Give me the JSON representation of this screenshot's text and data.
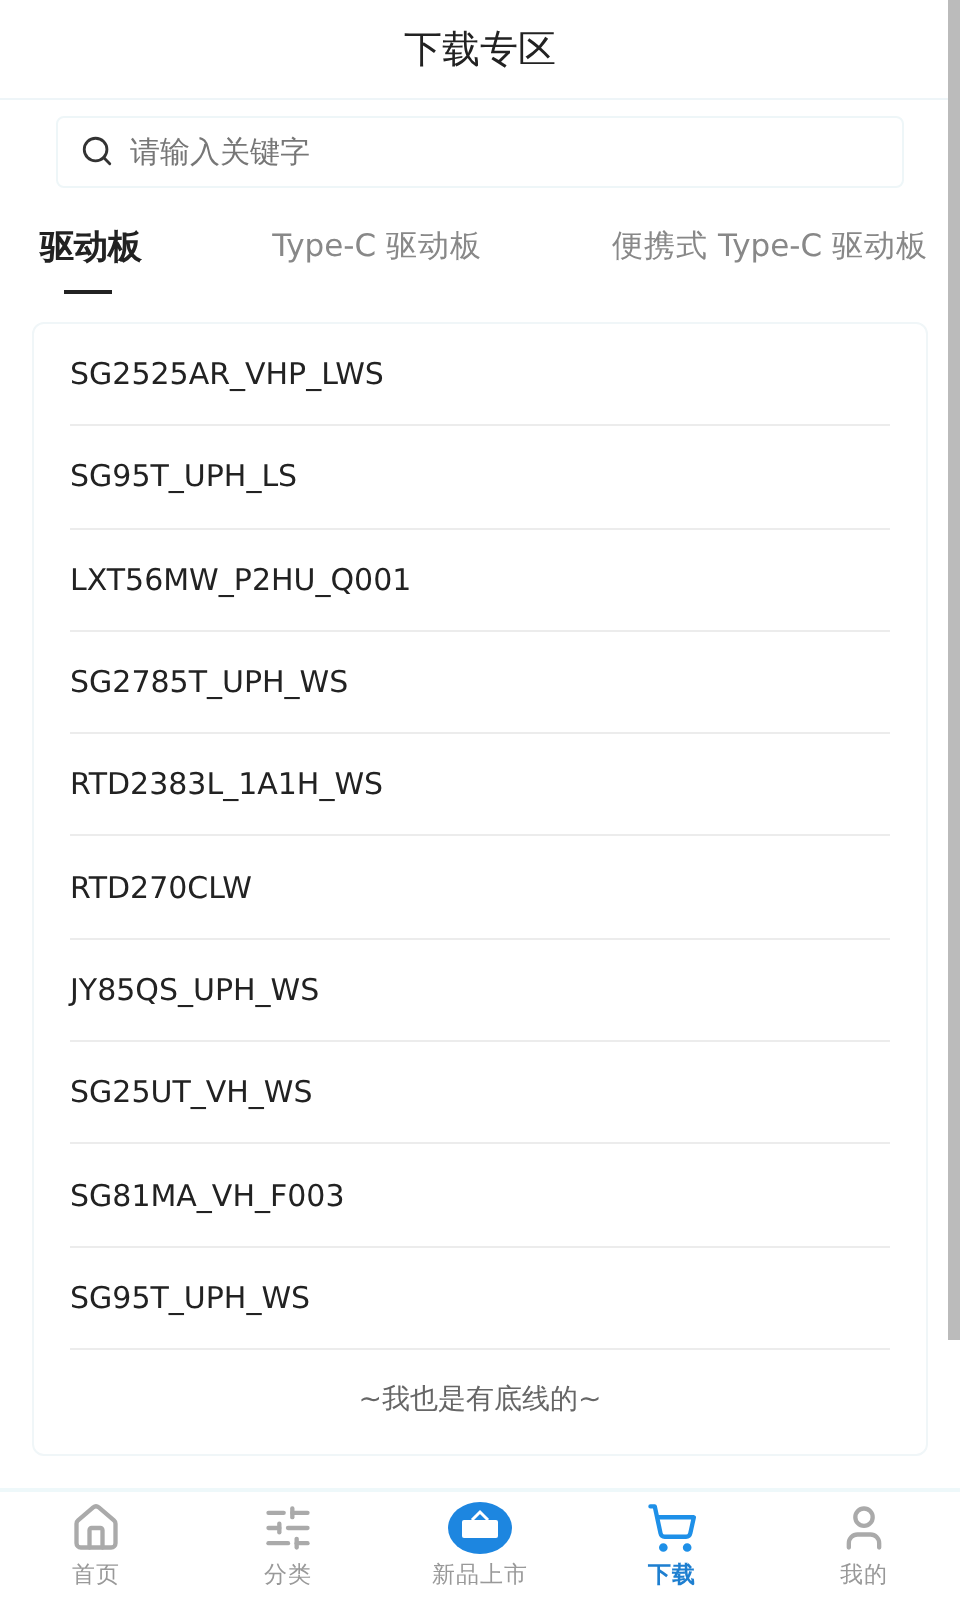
{
  "header": {
    "title": "下载专区"
  },
  "search": {
    "placeholder": "请输入关键字"
  },
  "tabs": [
    {
      "label": "驱动板",
      "selected": true
    },
    {
      "label": "Type-C 驱动板",
      "selected": false
    },
    {
      "label": "便携式 Type-C 驱动板",
      "selected": false
    }
  ],
  "items": [
    "SG2525AR_VHP_LWS",
    "SG95T_UPH_LS",
    "LXT56MW_P2HU_Q001",
    "SG2785T_UPH_WS",
    "RTD2383L_1A1H_WS",
    "RTD270CLW",
    "JY85QS_UPH_WS",
    "SG25UT_VH_WS",
    "SG81MA_VH_F003",
    "SG95T_UPH_WS"
  ],
  "end_note": "~我也是有底线的~",
  "nav": [
    {
      "kind": "home",
      "label": "首页",
      "selected": false
    },
    {
      "kind": "category",
      "label": "分类",
      "selected": false
    },
    {
      "kind": "new",
      "label": "新品上市",
      "selected": false
    },
    {
      "kind": "download",
      "label": "下载",
      "selected": true
    },
    {
      "kind": "profile",
      "label": "我的",
      "selected": false
    }
  ]
}
